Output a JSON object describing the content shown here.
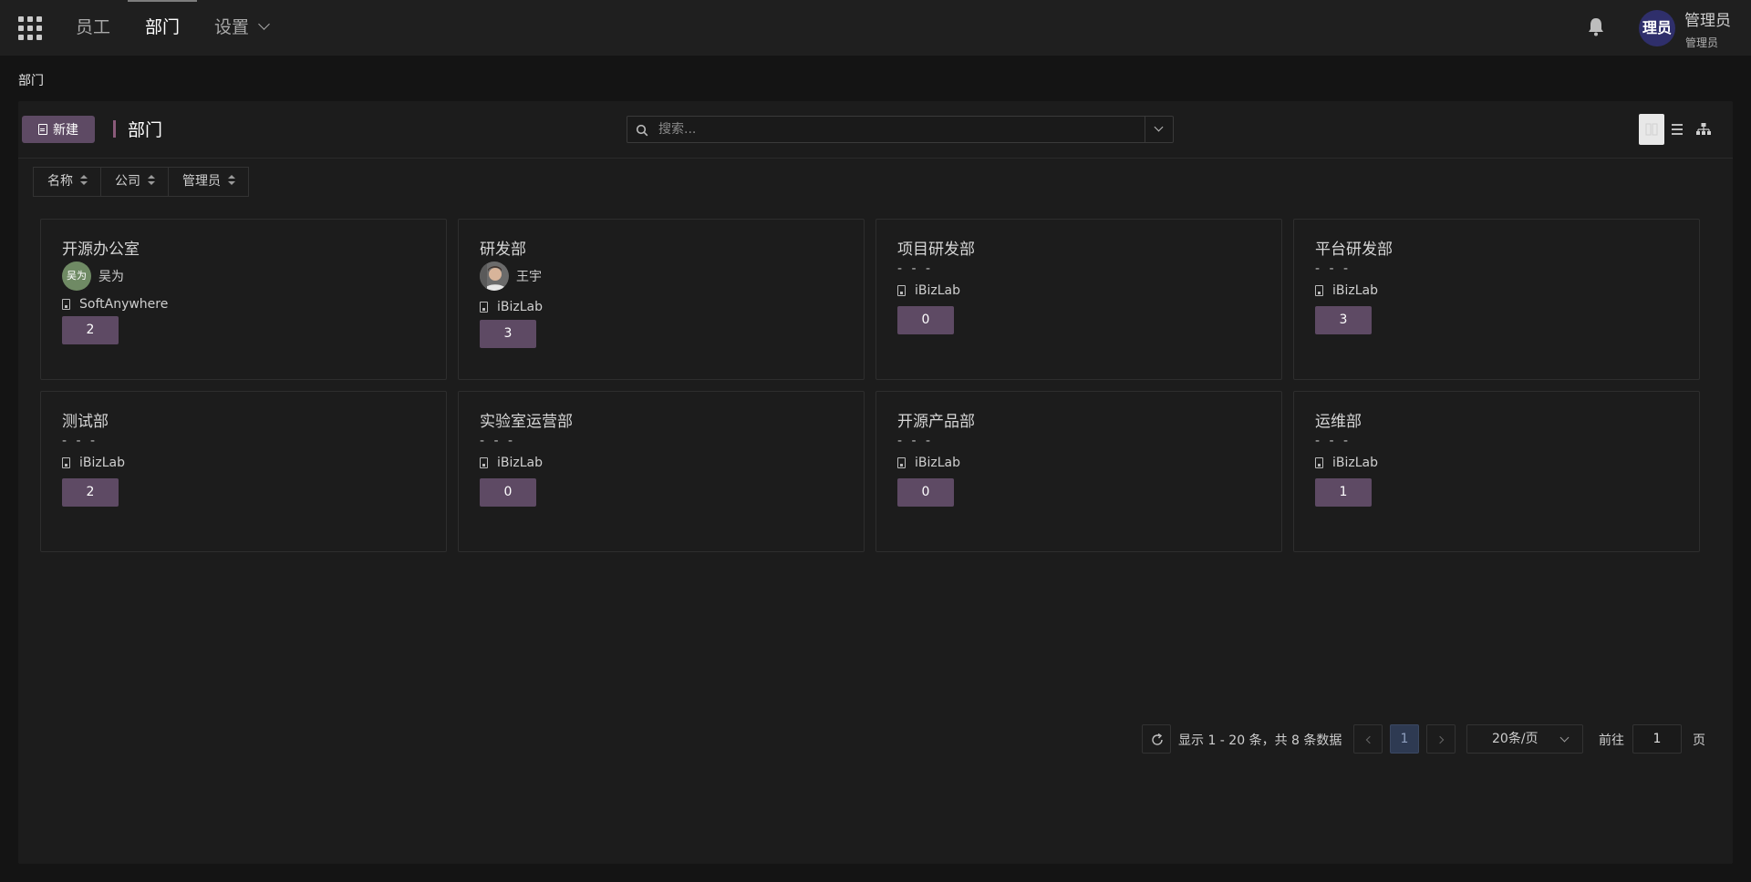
{
  "nav": {
    "items": [
      {
        "label": "员工"
      },
      {
        "label": "部门"
      },
      {
        "label": "设置"
      }
    ]
  },
  "user": {
    "avatar_text": "理员",
    "name": "管理员",
    "role": "管理员"
  },
  "breadcrumb": "部门",
  "toolbar": {
    "new_label": "新建",
    "title": "部门",
    "search_placeholder": "搜索..."
  },
  "sort": {
    "fields": [
      "名称",
      "公司",
      "管理员"
    ]
  },
  "departments": [
    {
      "name": "开源办公室",
      "manager": "吴为",
      "manager_avatar_text": "吴为",
      "company": "SoftAnywhere",
      "count": "2"
    },
    {
      "name": "研发部",
      "manager": "王宇",
      "company": "iBizLab",
      "count": "3"
    },
    {
      "name": "项目研发部",
      "manager": "- - -",
      "company": "iBizLab",
      "count": "0"
    },
    {
      "name": "平台研发部",
      "manager": "- - -",
      "company": "iBizLab",
      "count": "3"
    },
    {
      "name": "测试部",
      "manager": "- - -",
      "company": "iBizLab",
      "count": "2"
    },
    {
      "name": "实验室运营部",
      "manager": "- - -",
      "company": "iBizLab",
      "count": "0"
    },
    {
      "name": "开源产品部",
      "manager": "- - -",
      "company": "iBizLab",
      "count": "0"
    },
    {
      "name": "运维部",
      "manager": "- - -",
      "company": "iBizLab",
      "count": "1"
    }
  ],
  "pagination": {
    "info": "显示 1 - 20 条，共 8 条数据",
    "current_page": "1",
    "page_size": "20条/页",
    "goto_label": "前往",
    "goto_value": "1",
    "page_suffix": "页"
  },
  "colors": {
    "accent": "#5e4a64",
    "background": "#141414",
    "panel": "#1c1c1c",
    "user_avatar": "#2f2f6b",
    "manager_avatar": "#6f8a64"
  }
}
